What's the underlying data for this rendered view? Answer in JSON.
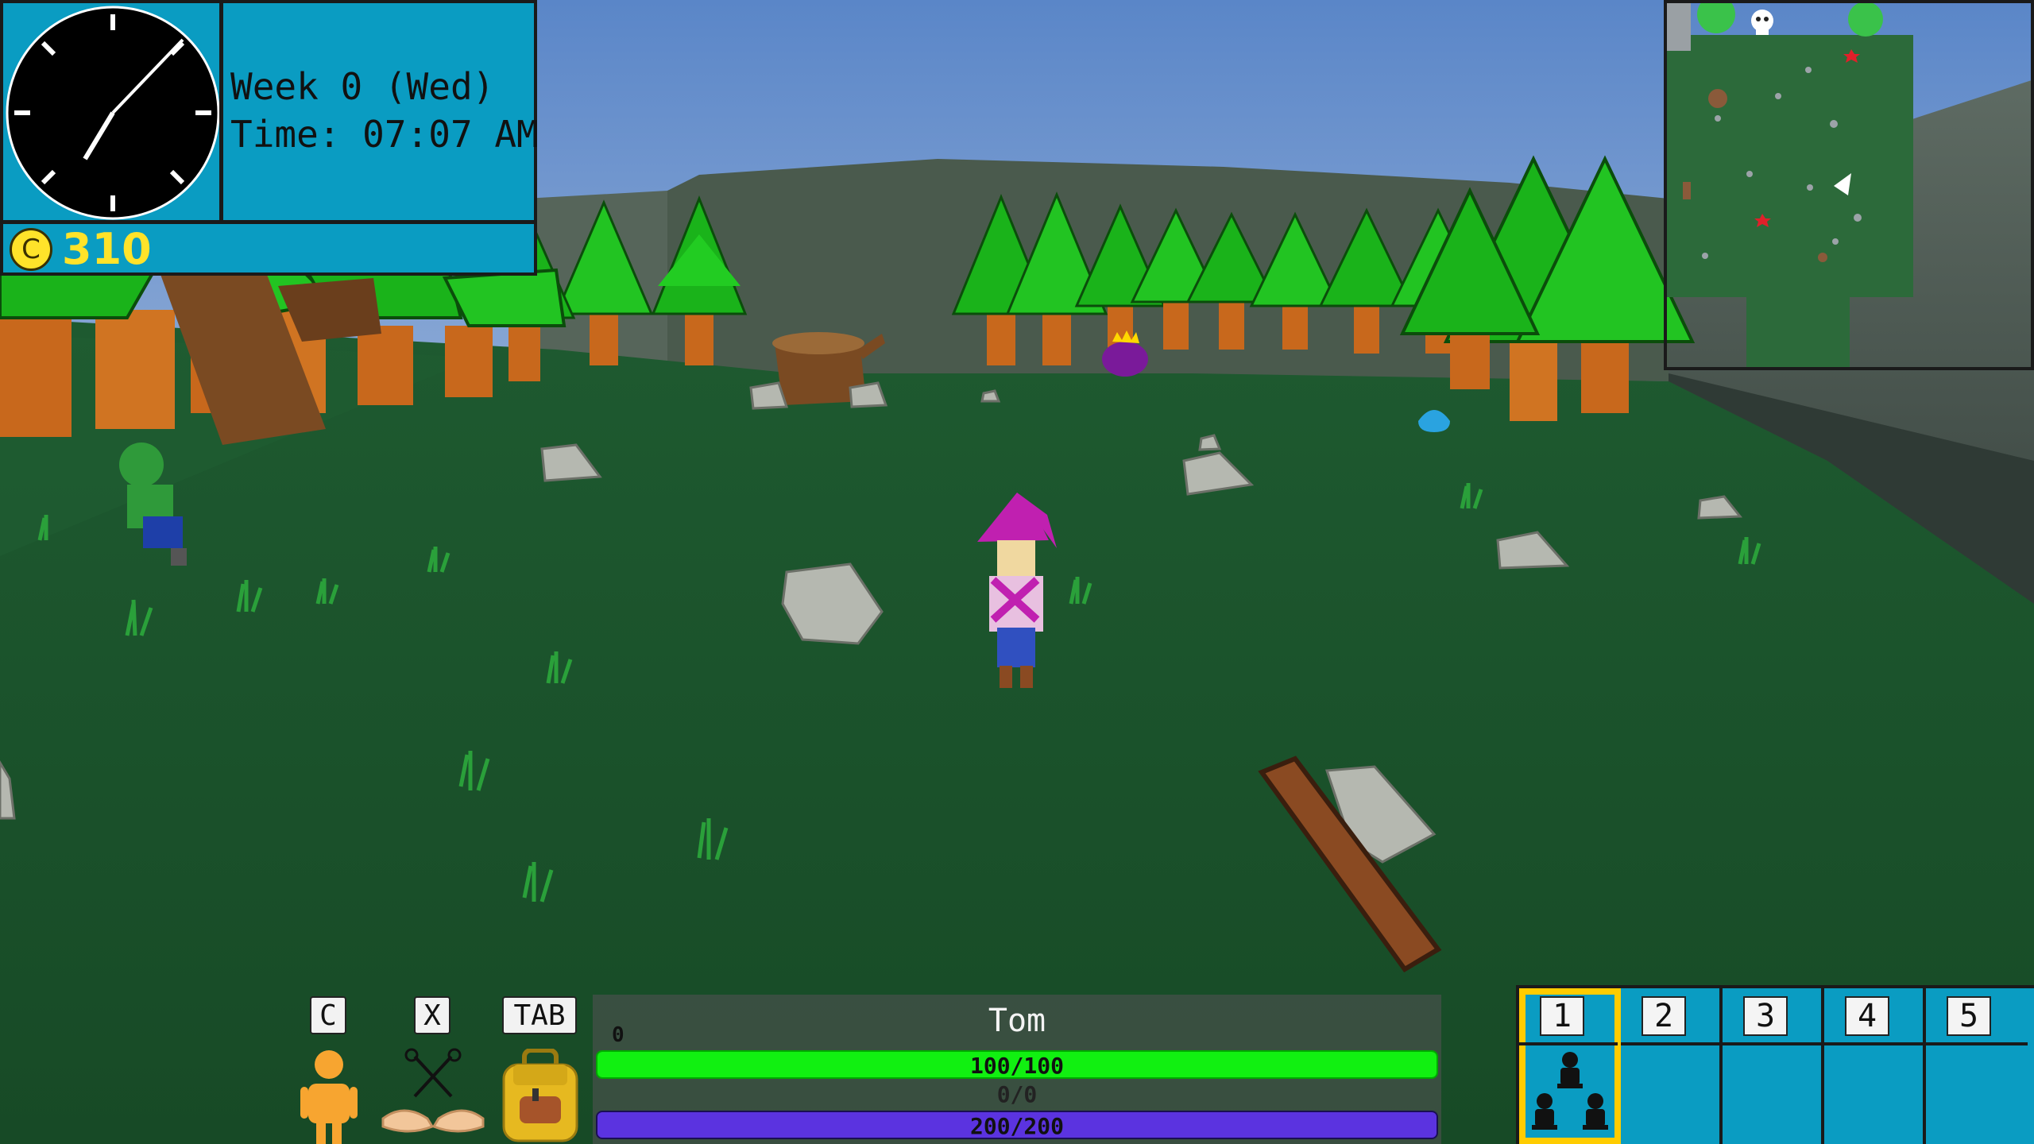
{
  "hud": {
    "clock": {
      "week_label": "Week 0 (Wed)",
      "time_label": "Time: 07:07 AM"
    },
    "coins": {
      "icon": "coin-icon",
      "icon_glyph": "C",
      "value": "310"
    },
    "keys": {
      "character": "C",
      "skills": "X",
      "inventory": "TAB"
    },
    "player": {
      "name": "Tom",
      "xp": "0",
      "hp_text": "100/100",
      "hp_fraction": 1.0,
      "stamina_text": "0/0",
      "mana_text": "200/200",
      "mana_fraction": 1.0
    },
    "hotbar": {
      "selected": 1,
      "slots": [
        {
          "label": "1",
          "item_icon": "figures-icon"
        },
        {
          "label": "2"
        },
        {
          "label": "3"
        },
        {
          "label": "4"
        },
        {
          "label": "5"
        }
      ]
    },
    "minimap": {
      "skull_icon": "skull-icon",
      "player_marker": "player-arrow-icon"
    }
  },
  "colors": {
    "hud_panel": "#0a9cc2",
    "coin": "#ffe32a",
    "hp": "#11f011",
    "mana": "#5b33e0",
    "hotbar_selected": "#ffcc00",
    "grass": "#1c5a2e",
    "sky_top": "#5a86c8"
  }
}
